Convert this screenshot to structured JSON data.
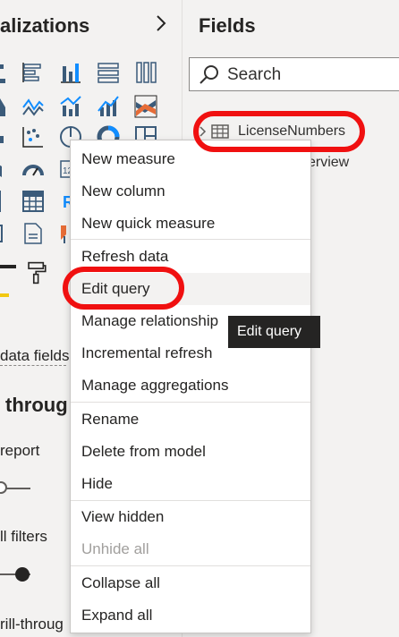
{
  "visualizations": {
    "title": "alizations",
    "expand_icon": "chevron-right-icon",
    "data_fields_label": "data fields",
    "drill_through_heading": "throug",
    "cross_report_label": "report",
    "all_filters_label": "ll filters",
    "drill_through_footer": "rill-throug"
  },
  "fields": {
    "title": "Fields",
    "search": {
      "placeholder": "Search"
    },
    "tree": {
      "table_name": "LicenseNumbers",
      "partial_item": "erview"
    }
  },
  "context_menu": {
    "items": [
      {
        "label": "New measure"
      },
      {
        "label": "New column"
      },
      {
        "label": "New quick measure"
      },
      {
        "label": "Refresh data"
      },
      {
        "label": "Edit query"
      },
      {
        "label": "Manage relationship"
      },
      {
        "label": "Incremental refresh"
      },
      {
        "label": "Manage aggregations"
      },
      {
        "label": "Rename"
      },
      {
        "label": "Delete from model"
      },
      {
        "label": "Hide"
      },
      {
        "label": "View hidden"
      },
      {
        "label": "Unhide all"
      },
      {
        "label": "Collapse all"
      },
      {
        "label": "Expand all"
      }
    ],
    "hovered_item": "Edit query",
    "disabled_item": "Unhide all"
  },
  "tooltip": {
    "text": "Edit query"
  },
  "colors": {
    "accent": "#f2c811",
    "annotation": "#f01010",
    "chart_blue": "#118dff",
    "chart_dark": "#3b5b7a"
  }
}
